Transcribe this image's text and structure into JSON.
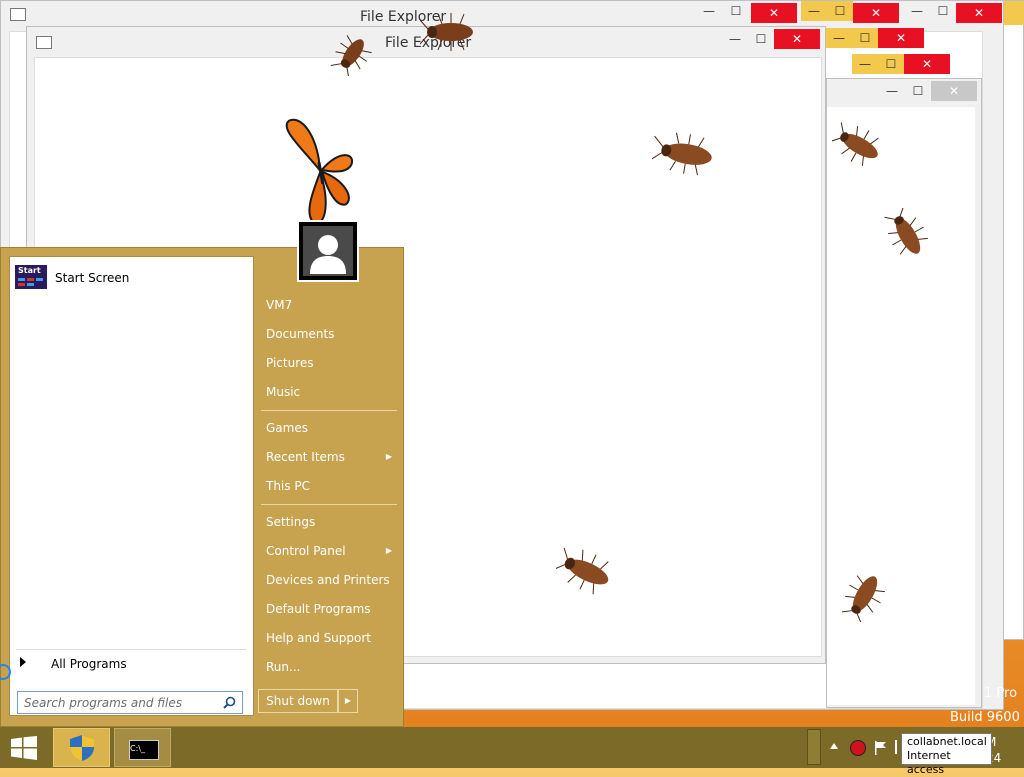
{
  "windows": {
    "back_title": "File Explorer",
    "front_title": "File Explorer",
    "min_glyph": "—",
    "max_glyph": "☐",
    "close_glyph": "✕"
  },
  "desktop": {
    "watermark_line1": "1 Pro",
    "watermark_line2": "Build 9600"
  },
  "start_menu": {
    "user_icon": "user-avatar-icon",
    "pinned": [
      {
        "label": "Start Screen",
        "icon": "start-screen-icon"
      }
    ],
    "all_programs": "All Programs",
    "search_placeholder": "Search programs and files",
    "right_items": {
      "vm7": "VM7",
      "documents": "Documents",
      "pictures": "Pictures",
      "music": "Music",
      "games": "Games",
      "recent_items": "Recent Items",
      "this_pc": "This PC",
      "settings": "Settings",
      "control_panel": "Control Panel",
      "devices_printers": "Devices and Printers",
      "default_programs": "Default Programs",
      "help_support": "Help and Support",
      "run": "Run..."
    },
    "shutdown": "Shut down",
    "start_screen_badge": "Start"
  },
  "taskbar": {
    "tooltip_line1": "collabnet.local",
    "tooltip_line2": "Internet access",
    "clock_fragment_top": "M",
    "clock_fragment_bottom": "24"
  },
  "colors": {
    "accent": "#c7a350",
    "taskbar": "#7b6a28",
    "close_red": "#e81123"
  }
}
